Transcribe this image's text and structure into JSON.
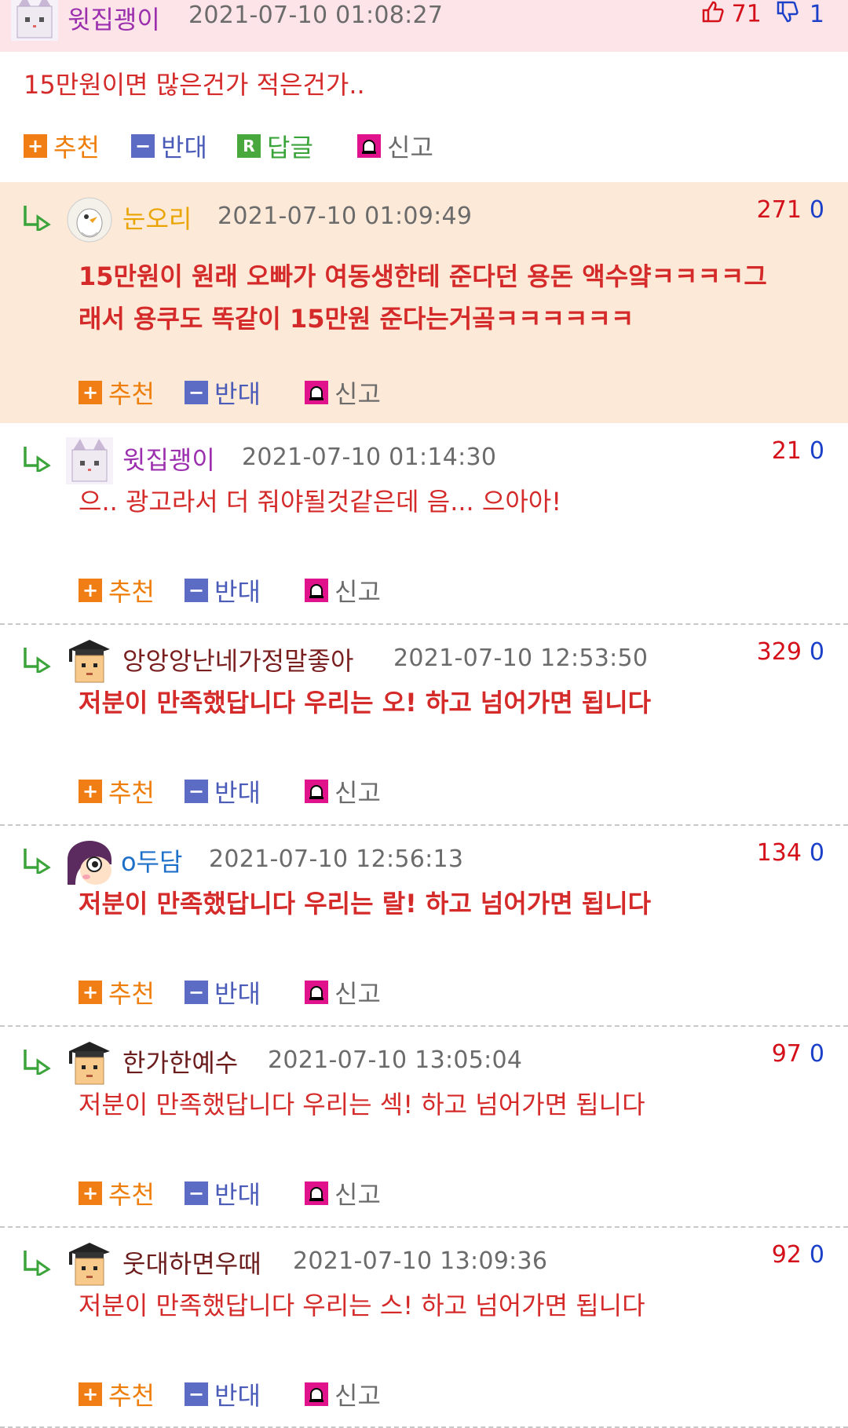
{
  "top": {
    "nick": "윗집괭이",
    "date": "2021-07-10 01:08:27",
    "up": "71",
    "down": "1",
    "text": "15만원이면 많은건가 적은건가..",
    "actions": {
      "recommend": "추천",
      "oppose": "반대",
      "reply": "답글",
      "report": "신고"
    }
  },
  "replies": [
    {
      "nick": "눈오리",
      "nick_color": "#e9a400",
      "date": "2021-07-10 01:09:49",
      "up": "271",
      "down": "0",
      "line1": "15만원이 원래 오빠가 여동생한테 준다던 용돈 액수얔ㅋㅋㅋㅋ그",
      "line2": "래서 용쿠도 똑같이 15만원 준다는거곸ㅋㅋㅋㅋㅋㅋ"
    },
    {
      "nick": "윗집괭이",
      "nick_color": "#9b2fae",
      "date": "2021-07-10 01:14:30",
      "up": "21",
      "down": "0",
      "line1": "으.. 광고라서 더 줘야될것같은데 음... 으아아!"
    },
    {
      "nick": "앙앙앙난네가정말좋아",
      "nick_color": "#7a1f1f",
      "date": "2021-07-10 12:53:50",
      "up": "329",
      "down": "0",
      "line1": "저분이 만족했답니다 우리는 오! 하고 넘어가면 됩니다"
    },
    {
      "nick": "o두담",
      "nick_color": "#1e70c8",
      "date": "2021-07-10 12:56:13",
      "up": "134",
      "down": "0",
      "line1": "저분이 만족했답니다 우리는 랄! 하고 넘어가면 됩니다"
    },
    {
      "nick": "한가한예수",
      "nick_color": "#6b1d1d",
      "date": "2021-07-10 13:05:04",
      "up": "97",
      "down": "0",
      "line1": "저분이 만족했답니다 우리는 섹! 하고 넘어가면 됩니다"
    },
    {
      "nick": "웃대하면우때",
      "nick_color": "#6b1d1d",
      "date": "2021-07-10 13:09:36",
      "up": "92",
      "down": "0",
      "line1": "저분이 만족했답니다 우리는 스! 하고 넘어가면 됩니다"
    }
  ],
  "reply_actions": {
    "recommend": "추천",
    "oppose": "반대",
    "report": "신고"
  },
  "icons": {
    "reply_arrow": "reply-arrow-icon",
    "recommend": "plus-icon",
    "oppose": "minus-icon",
    "reply": "r-icon",
    "report": "siren-icon",
    "thumb_up": "thumb-up-icon",
    "thumb_down": "thumb-down-icon"
  }
}
